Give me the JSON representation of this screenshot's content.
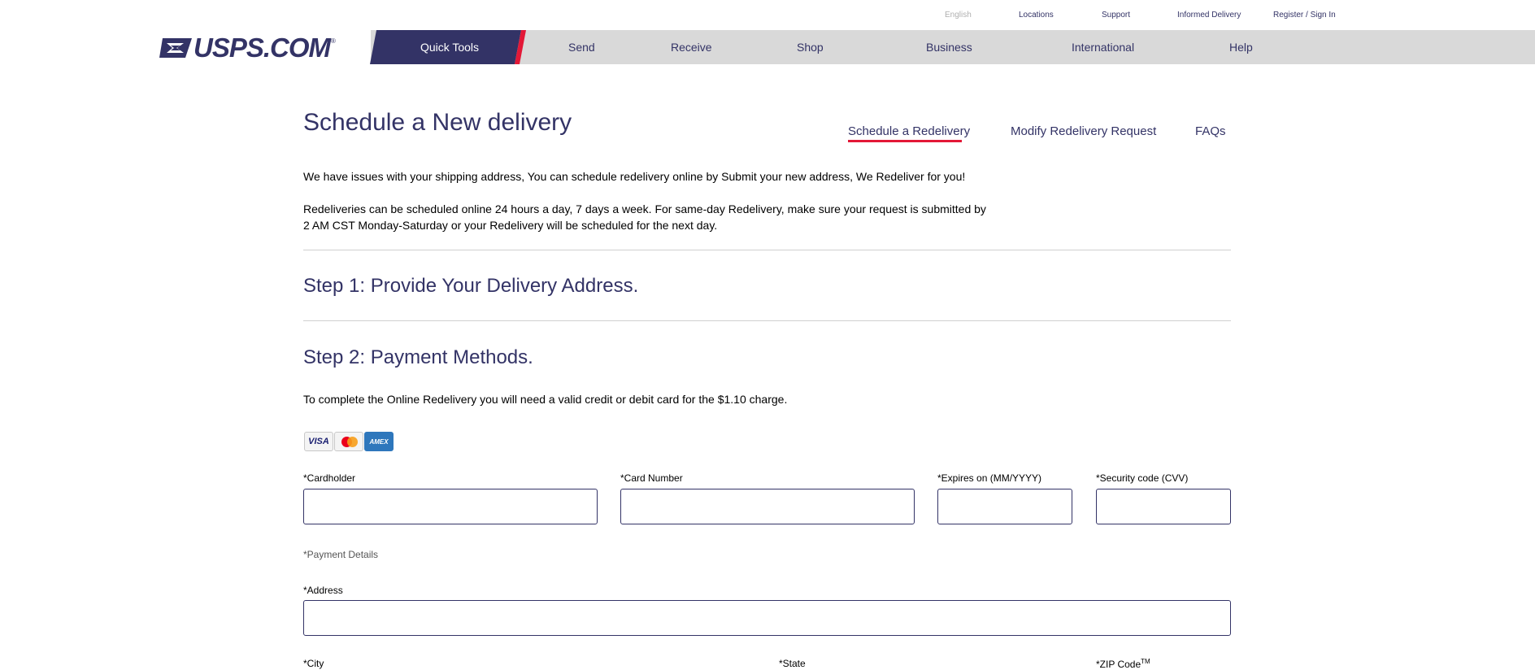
{
  "utility_nav": {
    "english": "English",
    "locations": "Locations",
    "support": "Support",
    "informed_delivery": "Informed Delivery",
    "register": "Register / Sign In"
  },
  "logo": {
    "text": "USPS.COM",
    "registered": "®"
  },
  "main_nav": {
    "quick_tools": "Quick Tools",
    "send": "Send",
    "receive": "Receive",
    "shop": "Shop",
    "business": "Business",
    "international": "International",
    "help": "Help"
  },
  "page": {
    "title": "Schedule a New delivery",
    "subnav": {
      "schedule": "Schedule a Redelivery",
      "modify": "Modify Redelivery Request",
      "faqs": "FAQs"
    },
    "intro": "We have issues with your shipping address, You can schedule redelivery online by Submit your new address, We Redeliver for you!",
    "info": "Redeliveries can be scheduled online 24 hours a day, 7 days a week. For same-day Redelivery, make sure your request is submitted by 2 AM CST Monday-Saturday or your Redelivery will be scheduled for the next day.",
    "step1": "Step 1: Provide Your Delivery Address.",
    "step2": "Step 2: Payment Methods.",
    "payment_note": "To complete the Online Redelivery you will need a valid credit or debit card for the $1.10 charge."
  },
  "cards": {
    "visa": "VISA",
    "amex": "AMEX"
  },
  "form": {
    "cardholder": {
      "label": "*Cardholder",
      "value": ""
    },
    "card_number": {
      "label": "*Card Number",
      "value": ""
    },
    "expires": {
      "label": "*Expires on (MM/YYYY)",
      "value": ""
    },
    "cvv": {
      "label": "*Security code (CVV)",
      "value": ""
    },
    "payment_details": "*Payment Details",
    "address": {
      "label": "*Address",
      "value": ""
    },
    "city": {
      "label": "*City"
    },
    "state": {
      "label": "*State"
    },
    "zip": {
      "label": "*ZIP Code",
      "tm": "TM"
    }
  },
  "colors": {
    "brand_navy": "#333366",
    "brand_red": "#e31837",
    "nav_gray": "#d9d9d9"
  }
}
